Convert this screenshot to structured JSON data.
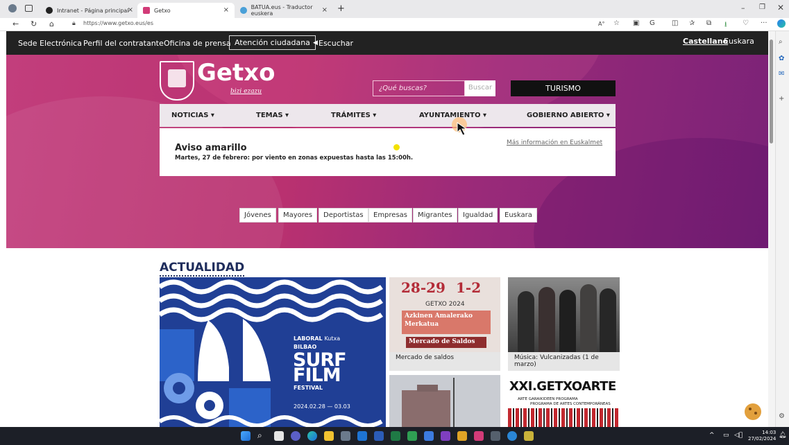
{
  "browser": {
    "tabs": [
      {
        "label": "Intranet - Página principal",
        "active": false
      },
      {
        "label": "Getxo",
        "active": true
      },
      {
        "label": "BATUA.eus - Traductor euskera",
        "active": false
      }
    ],
    "url": "https://www.getxo.eus/es"
  },
  "topnav": {
    "items": [
      "Sede Electrónica",
      "Perfil del contratante",
      "Oficina de prensa"
    ],
    "atencion": "Atención ciudadana",
    "listen": "Escuchar",
    "lang_active": "Castellano",
    "lang_other": "Euskara"
  },
  "header": {
    "logo_text": "Getxo",
    "logo_tagline": "bizi ezazu",
    "search_placeholder": "¿Qué buscas?",
    "search_button": "Buscar",
    "turismo": "TURISMO"
  },
  "mainnav": {
    "items": [
      "NOTICIAS",
      "TEMAS",
      "TRÁMITES",
      "AYUNTAMIENTO",
      "GOBIERNO ABIERTO"
    ]
  },
  "alert": {
    "title": "Aviso amarillo",
    "description": "Martes, 27 de febrero: por viento en zonas expuestas hasta las 15:00h.",
    "link": "Más información en Euskalmet",
    "dot_color": "#f3e100"
  },
  "audiences": [
    "Jóvenes",
    "Mayores",
    "Deportistas",
    "Empresas",
    "Migrantes",
    "Igualdad",
    "Euskara"
  ],
  "actualidad": {
    "title": "ACTUALIDAD",
    "big_card": {
      "sponsor_a": "LABORAL",
      "sponsor_b": "Kutxa",
      "city": "BILBAO",
      "line1": "SURF",
      "line2": "FILM",
      "line3": "FESTIVAL",
      "dates": "2024.02.28 — 03.03"
    },
    "saldos_card": {
      "dates_a": "28-29",
      "dates_b": "1-2",
      "year": "GETXO 2024",
      "poster_a": "Azkinen Amalerako Merkatua",
      "poster_b": "Mercado de Saldos",
      "caption": "Mercado de saldos"
    },
    "music_card": {
      "caption": "Música: Vulcanizadas (1 de marzo)"
    },
    "getxoarte_card": {
      "title": "XXI.GETXOARTE",
      "subtitle_a": "ARTE GARAIKIDEEN PROGRAMA",
      "subtitle_b": "PROGRAMA DE ARTES CONTEMPORÁNEAS"
    }
  },
  "taskbar": {
    "time": "14:03",
    "date": "27/02/2024"
  },
  "colors": {
    "hero_pink": "#c23e7c",
    "hero_purple": "#7a2277",
    "topnav_bg": "#222222",
    "title_navy": "#1f2d5c",
    "surf_blue": "#203f95"
  }
}
